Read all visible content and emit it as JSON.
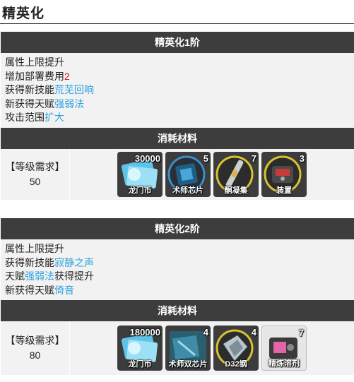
{
  "page_title": "精英化",
  "phases": [
    {
      "header": "精英化1阶",
      "lines": [
        {
          "text": "属性上限提升",
          "value": ""
        },
        {
          "text": "增加部署费用",
          "value": "2"
        },
        {
          "text": "获得新技能",
          "value": "荒芜回响"
        },
        {
          "text": "新获得天赋",
          "value": "强弱法"
        },
        {
          "text": "攻击范围",
          "value": "扩大"
        }
      ],
      "materials_header": "消耗材料",
      "req_label": "【等级需求】",
      "req_value": "50",
      "items": [
        {
          "name": "龙门币",
          "count": "30000",
          "icon": "lmd-icon"
        },
        {
          "name": "术师芯片",
          "count": "5",
          "icon": "caster-chip-icon"
        },
        {
          "name": "酮凝集",
          "count": "7",
          "icon": "oriron-icon"
        },
        {
          "name": "装置",
          "count": "3",
          "icon": "device-icon"
        }
      ]
    },
    {
      "header": "精英化2阶",
      "lines": [
        {
          "text": "属性上限提升",
          "value": ""
        },
        {
          "text": "获得新技能",
          "value": "寂静之声"
        },
        {
          "text": "天赋",
          "value": "强弱法",
          "suffix": "获得提升"
        },
        {
          "text": "新获得天赋",
          "value": "倚音"
        }
      ],
      "materials_header": "消耗材料",
      "req_label": "【等级需求】",
      "req_value": "80",
      "items": [
        {
          "name": "龙门币",
          "count": "180000",
          "icon": "lmd-icon"
        },
        {
          "name": "术师双芯片",
          "count": "4",
          "icon": "caster-dualchip-icon"
        },
        {
          "name": "D32钢",
          "count": "4",
          "icon": "d32-steel-icon"
        },
        {
          "name": "精炼溶剂",
          "count": "7",
          "icon": "refined-solvent-icon"
        }
      ]
    }
  ],
  "colors": {
    "header_bg": "#3d3d3d",
    "highlight": "#2aa1e0",
    "cost": "#e01010"
  }
}
